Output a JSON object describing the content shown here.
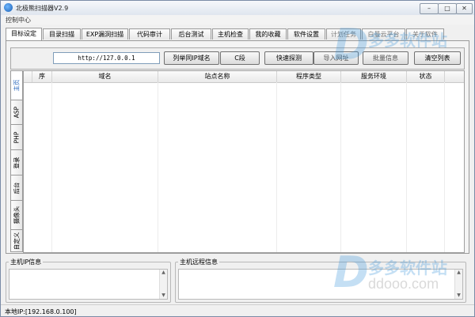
{
  "window": {
    "title": "北极熊扫描器V2.9",
    "menu": "控制中心",
    "minimize_glyph": "–",
    "maximize_glyph": "□",
    "close_glyph": "✕"
  },
  "tabs": [
    {
      "label": "目标设定",
      "active": true
    },
    {
      "label": "目录扫描"
    },
    {
      "label": "EXP漏洞扫描"
    },
    {
      "label": "代码审计"
    },
    {
      "label": "后台测试"
    },
    {
      "label": "主机检查"
    },
    {
      "label": "我的收藏"
    },
    {
      "label": "软件设置"
    },
    {
      "label": "计划任务"
    },
    {
      "label": "白曼云平台"
    },
    {
      "label": "关于软件"
    }
  ],
  "toolbar": {
    "url_value": "http://127.0.0.1",
    "buttons": [
      "列举同IP域名",
      "C段",
      "快速探测",
      "导入网址",
      "批量信息",
      "清空列表"
    ]
  },
  "side_tabs": [
    "主页",
    "ASP",
    "PHP",
    "登录",
    "后台",
    "摄像头",
    "自定义"
  ],
  "table": {
    "columns": [
      "序",
      "域名",
      "站点名称",
      "程序类型",
      "服务环境",
      "状态"
    ],
    "rows": []
  },
  "bottom": {
    "ip_info_title": "主机IP信息",
    "remote_info_title": "主机远程信息"
  },
  "status": {
    "text": "本地IP:[192.168.0.100]"
  },
  "watermark": {
    "logo_letter": "D",
    "brand": "多多软件站",
    "url": "ddooo.com"
  },
  "colors": {
    "accent_blue": "#1b5db8",
    "watermark_blue": "#2f8fd8"
  }
}
